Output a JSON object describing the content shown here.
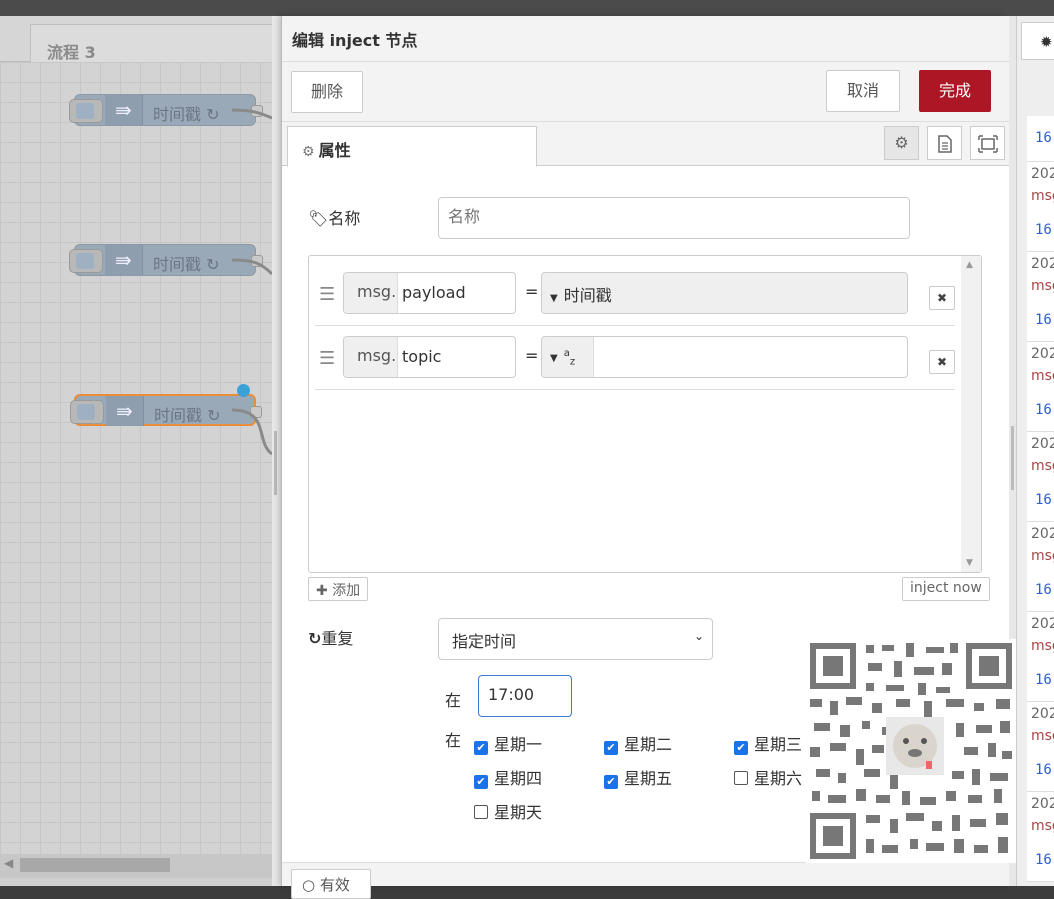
{
  "workspace": {
    "tab_label": "流程 3",
    "nodes": [
      {
        "label": "时间戳 ↻",
        "selected": false
      },
      {
        "label": "时间戳 ↻",
        "selected": false
      },
      {
        "label": "时间戳 ↻",
        "selected": true
      }
    ]
  },
  "editor": {
    "title": "编辑 inject 节点",
    "delete_label": "删除",
    "cancel_label": "取消",
    "done_label": "完成",
    "tab_label": "属性",
    "name_label": "名称",
    "name_placeholder": "名称",
    "properties": [
      {
        "prefix": "msg.",
        "key": "payload",
        "type_label": "时间戳"
      },
      {
        "prefix": "msg.",
        "key": "topic",
        "type_label": "a z"
      }
    ],
    "add_label": "添加",
    "inject_now_label": "inject now",
    "repeat_label": "重复",
    "repeat_value": "指定时间",
    "at_label": "在",
    "time_value": "17:00",
    "on_label": "在",
    "days": [
      {
        "label": "星期一",
        "checked": true
      },
      {
        "label": "星期二",
        "checked": true
      },
      {
        "label": "星期三",
        "checked": true
      },
      {
        "label": "星期四",
        "checked": true
      },
      {
        "label": "星期五",
        "checked": true
      },
      {
        "label": "星期六",
        "checked": false
      },
      {
        "label": "星期天",
        "checked": false
      }
    ],
    "footer_label": "有效"
  },
  "sidebar": {
    "tab_label": "⁠",
    "items": [
      {
        "d": "202",
        "m": "msg",
        "n": "16"
      },
      {
        "d": "202",
        "m": "msg",
        "n": "16"
      },
      {
        "d": "202",
        "m": "msg",
        "n": "16"
      },
      {
        "d": "202",
        "m": "msg",
        "n": "16"
      },
      {
        "d": "202",
        "m": "msg",
        "n": "16"
      },
      {
        "d": "202",
        "m": "msg",
        "n": "16"
      },
      {
        "d": "202",
        "m": "msg",
        "n": "16"
      },
      {
        "d": "202",
        "m": "msg",
        "n": "16"
      }
    ],
    "first_number": "16"
  },
  "colors": {
    "done_button": "#ad1625",
    "node_fill": "#9aa9b8",
    "selected_border": "#e88d3c",
    "checkbox": "#1a73e8"
  }
}
